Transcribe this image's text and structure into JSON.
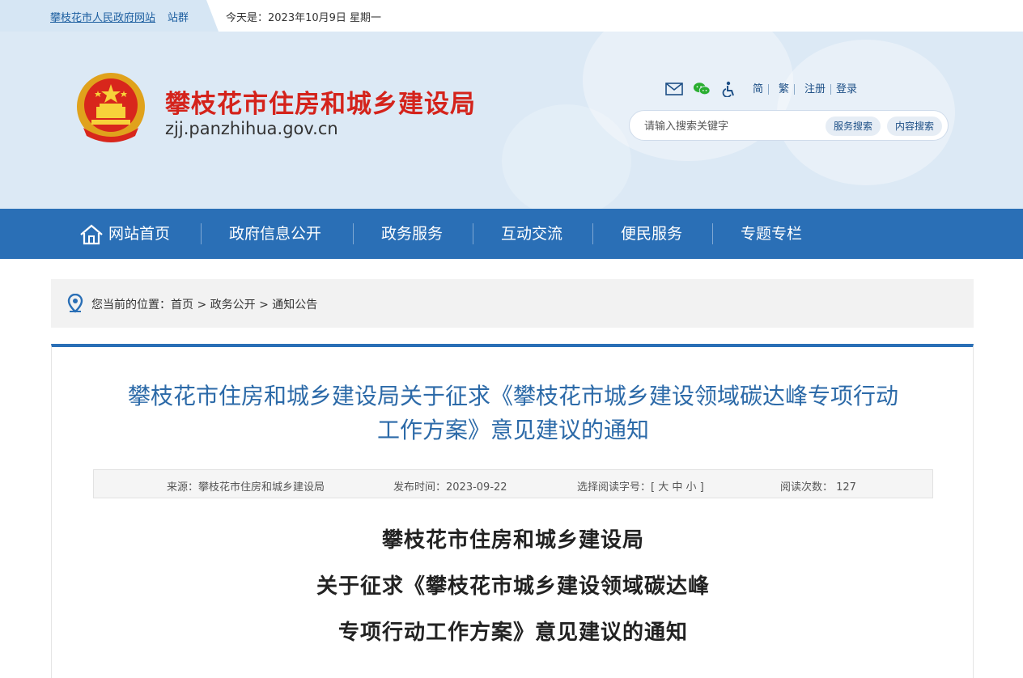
{
  "topbar": {
    "gov_link": "攀枝花市人民政府网站",
    "station_group": "站群",
    "date_text": "今天是：2023年10月9日 星期一"
  },
  "header": {
    "site_title": "攀枝花市住房和城乡建设局",
    "site_domain": "zjj.panzhihua.gov.cn",
    "tools": {
      "icons": [
        "mail-icon",
        "wechat-icon",
        "accessibility-icon"
      ],
      "simplified": "简",
      "traditional": "繁",
      "register": "注册",
      "login": "登录"
    },
    "search": {
      "placeholder": "请输入搜索关键字",
      "service_search": "服务搜索",
      "content_search": "内容搜索"
    }
  },
  "nav": {
    "items": [
      {
        "label": "网站首页"
      },
      {
        "label": "政府信息公开"
      },
      {
        "label": "政务服务"
      },
      {
        "label": "互动交流"
      },
      {
        "label": "便民服务"
      },
      {
        "label": "专题专栏"
      }
    ]
  },
  "breadcrumb": {
    "prefix": "您当前的位置：",
    "items": [
      "首页",
      "政务公开",
      "通知公告"
    ],
    "separator": ">"
  },
  "article": {
    "title_line1": "攀枝花市住房和城乡建设局关于征求《攀枝花市城乡建设领域碳达峰专项行动",
    "title_line2": "工作方案》意见建议的通知",
    "meta": {
      "source": "来源：攀枝花市住房和城乡建设局",
      "publish_time": "发布时间：2023-09-22",
      "font_size_label": "选择阅读字号：[ 大 中 小 ]",
      "read_count": "阅读次数： 127"
    },
    "doc_lines": [
      "攀枝花市住房和城乡建设局",
      "关于征求《攀枝花市城乡建设领域碳达峰",
      "专项行动工作方案》意见建议的通知"
    ]
  },
  "colors": {
    "primary_blue": "#2a6fb6",
    "title_red": "#d4231b",
    "header_bg": "#dce9f5"
  }
}
